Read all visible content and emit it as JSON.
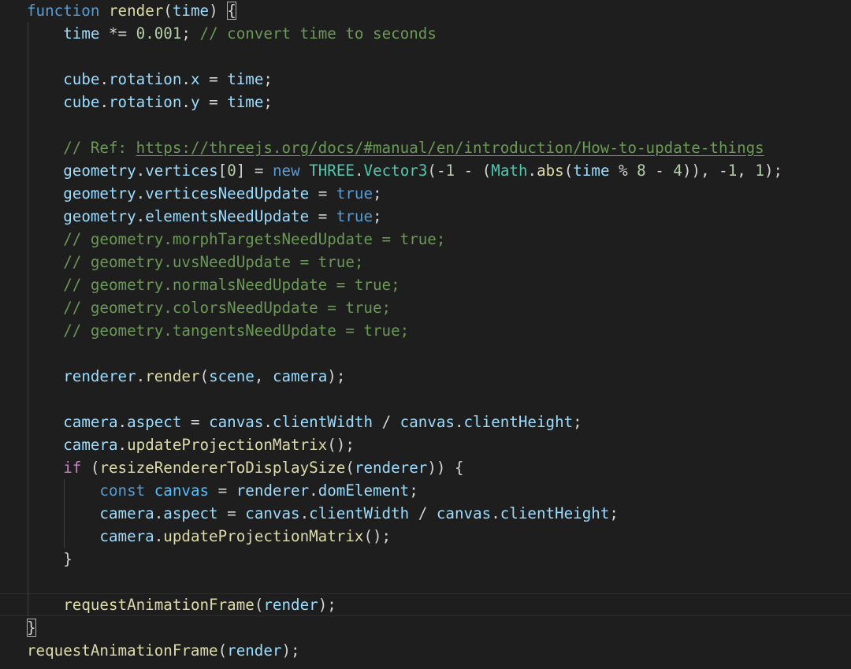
{
  "editor": {
    "theme": {
      "background": "#1e1e1e",
      "keyword": "#569cd6",
      "control": "#c586c0",
      "function": "#dcdcaa",
      "variable": "#9cdcfe",
      "constant": "#4fc1ff",
      "class": "#4ec9b0",
      "number": "#b5cea8",
      "comment": "#6a9955",
      "text": "#d4d4d4"
    },
    "lines": [
      {
        "indent": 0,
        "tokens": [
          [
            "kw",
            "function"
          ],
          [
            "pun",
            " "
          ],
          [
            "fn",
            "render"
          ],
          [
            "pun",
            "("
          ],
          [
            "var",
            "time"
          ],
          [
            "pun",
            ") "
          ],
          [
            "brm",
            "{"
          ]
        ]
      },
      {
        "indent": 1,
        "tokens": [
          [
            "pun",
            "    "
          ],
          [
            "var",
            "time"
          ],
          [
            "op",
            " *= "
          ],
          [
            "num",
            "0.001"
          ],
          [
            "pun",
            "; "
          ],
          [
            "com",
            "// convert time to seconds"
          ]
        ]
      },
      {
        "indent": 1,
        "tokens": []
      },
      {
        "indent": 1,
        "tokens": [
          [
            "pun",
            "    "
          ],
          [
            "var",
            "cube"
          ],
          [
            "pun",
            "."
          ],
          [
            "prop",
            "rotation"
          ],
          [
            "pun",
            "."
          ],
          [
            "prop",
            "x"
          ],
          [
            "op",
            " = "
          ],
          [
            "var",
            "time"
          ],
          [
            "pun",
            ";"
          ]
        ]
      },
      {
        "indent": 1,
        "tokens": [
          [
            "pun",
            "    "
          ],
          [
            "var",
            "cube"
          ],
          [
            "pun",
            "."
          ],
          [
            "prop",
            "rotation"
          ],
          [
            "pun",
            "."
          ],
          [
            "prop",
            "y"
          ],
          [
            "op",
            " = "
          ],
          [
            "var",
            "time"
          ],
          [
            "pun",
            ";"
          ]
        ]
      },
      {
        "indent": 1,
        "tokens": []
      },
      {
        "indent": 1,
        "tokens": [
          [
            "pun",
            "    "
          ],
          [
            "com",
            "// Ref: "
          ],
          [
            "lnk",
            "https://threejs.org/docs/#manual/en/introduction/How-to-update-things"
          ]
        ]
      },
      {
        "indent": 1,
        "tokens": [
          [
            "pun",
            "    "
          ],
          [
            "var",
            "geometry"
          ],
          [
            "pun",
            "."
          ],
          [
            "prop",
            "vertices"
          ],
          [
            "pun",
            "["
          ],
          [
            "num",
            "0"
          ],
          [
            "pun",
            "]"
          ],
          [
            "op",
            " = "
          ],
          [
            "kw",
            "new"
          ],
          [
            "pun",
            " "
          ],
          [
            "cls",
            "THREE"
          ],
          [
            "pun",
            "."
          ],
          [
            "cls",
            "Vector3"
          ],
          [
            "pun",
            "("
          ],
          [
            "op",
            "-"
          ],
          [
            "num",
            "1"
          ],
          [
            "op",
            " - "
          ],
          [
            "pun",
            "("
          ],
          [
            "cls",
            "Math"
          ],
          [
            "pun",
            "."
          ],
          [
            "fn",
            "abs"
          ],
          [
            "pun",
            "("
          ],
          [
            "var",
            "time"
          ],
          [
            "op",
            " % "
          ],
          [
            "num",
            "8"
          ],
          [
            "op",
            " - "
          ],
          [
            "num",
            "4"
          ],
          [
            "pun",
            "))"
          ],
          [
            "pun",
            ", "
          ],
          [
            "op",
            "-"
          ],
          [
            "num",
            "1"
          ],
          [
            "pun",
            ", "
          ],
          [
            "num",
            "1"
          ],
          [
            "pun",
            ");"
          ]
        ]
      },
      {
        "indent": 1,
        "tokens": [
          [
            "pun",
            "    "
          ],
          [
            "var",
            "geometry"
          ],
          [
            "pun",
            "."
          ],
          [
            "prop",
            "verticesNeedUpdate"
          ],
          [
            "op",
            " = "
          ],
          [
            "kw",
            "true"
          ],
          [
            "pun",
            ";"
          ]
        ]
      },
      {
        "indent": 1,
        "tokens": [
          [
            "pun",
            "    "
          ],
          [
            "var",
            "geometry"
          ],
          [
            "pun",
            "."
          ],
          [
            "prop",
            "elementsNeedUpdate"
          ],
          [
            "op",
            " = "
          ],
          [
            "kw",
            "true"
          ],
          [
            "pun",
            ";"
          ]
        ]
      },
      {
        "indent": 1,
        "tokens": [
          [
            "pun",
            "    "
          ],
          [
            "com",
            "// geometry.morphTargetsNeedUpdate = true;"
          ]
        ]
      },
      {
        "indent": 1,
        "tokens": [
          [
            "pun",
            "    "
          ],
          [
            "com",
            "// geometry.uvsNeedUpdate = true;"
          ]
        ]
      },
      {
        "indent": 1,
        "tokens": [
          [
            "pun",
            "    "
          ],
          [
            "com",
            "// geometry.normalsNeedUpdate = true;"
          ]
        ]
      },
      {
        "indent": 1,
        "tokens": [
          [
            "pun",
            "    "
          ],
          [
            "com",
            "// geometry.colorsNeedUpdate = true;"
          ]
        ]
      },
      {
        "indent": 1,
        "tokens": [
          [
            "pun",
            "    "
          ],
          [
            "com",
            "// geometry.tangentsNeedUpdate = true;"
          ]
        ]
      },
      {
        "indent": 1,
        "tokens": []
      },
      {
        "indent": 1,
        "tokens": [
          [
            "pun",
            "    "
          ],
          [
            "var",
            "renderer"
          ],
          [
            "pun",
            "."
          ],
          [
            "fn",
            "render"
          ],
          [
            "pun",
            "("
          ],
          [
            "var",
            "scene"
          ],
          [
            "pun",
            ", "
          ],
          [
            "var",
            "camera"
          ],
          [
            "pun",
            ");"
          ]
        ]
      },
      {
        "indent": 1,
        "tokens": []
      },
      {
        "indent": 1,
        "tokens": [
          [
            "pun",
            "    "
          ],
          [
            "var",
            "camera"
          ],
          [
            "pun",
            "."
          ],
          [
            "prop",
            "aspect"
          ],
          [
            "op",
            " = "
          ],
          [
            "var",
            "canvas"
          ],
          [
            "pun",
            "."
          ],
          [
            "prop",
            "clientWidth"
          ],
          [
            "op",
            " / "
          ],
          [
            "var",
            "canvas"
          ],
          [
            "pun",
            "."
          ],
          [
            "prop",
            "clientHeight"
          ],
          [
            "pun",
            ";"
          ]
        ]
      },
      {
        "indent": 1,
        "tokens": [
          [
            "pun",
            "    "
          ],
          [
            "var",
            "camera"
          ],
          [
            "pun",
            "."
          ],
          [
            "fn",
            "updateProjectionMatrix"
          ],
          [
            "pun",
            "();"
          ]
        ]
      },
      {
        "indent": 1,
        "tokens": [
          [
            "pun",
            "    "
          ],
          [
            "ctl",
            "if"
          ],
          [
            "pun",
            " ("
          ],
          [
            "fn",
            "resizeRendererToDisplaySize"
          ],
          [
            "pun",
            "("
          ],
          [
            "var",
            "renderer"
          ],
          [
            "pun",
            ")) {"
          ]
        ]
      },
      {
        "indent": 2,
        "tokens": [
          [
            "pun",
            "        "
          ],
          [
            "kw",
            "const"
          ],
          [
            "pun",
            " "
          ],
          [
            "cons",
            "canvas"
          ],
          [
            "op",
            " = "
          ],
          [
            "var",
            "renderer"
          ],
          [
            "pun",
            "."
          ],
          [
            "prop",
            "domElement"
          ],
          [
            "pun",
            ";"
          ]
        ]
      },
      {
        "indent": 2,
        "tokens": [
          [
            "pun",
            "        "
          ],
          [
            "var",
            "camera"
          ],
          [
            "pun",
            "."
          ],
          [
            "prop",
            "aspect"
          ],
          [
            "op",
            " = "
          ],
          [
            "var",
            "canvas"
          ],
          [
            "pun",
            "."
          ],
          [
            "prop",
            "clientWidth"
          ],
          [
            "op",
            " / "
          ],
          [
            "var",
            "canvas"
          ],
          [
            "pun",
            "."
          ],
          [
            "prop",
            "clientHeight"
          ],
          [
            "pun",
            ";"
          ]
        ]
      },
      {
        "indent": 2,
        "tokens": [
          [
            "pun",
            "        "
          ],
          [
            "var",
            "camera"
          ],
          [
            "pun",
            "."
          ],
          [
            "fn",
            "updateProjectionMatrix"
          ],
          [
            "pun",
            "();"
          ]
        ]
      },
      {
        "indent": 1,
        "tokens": [
          [
            "pun",
            "    }"
          ]
        ]
      },
      {
        "indent": 1,
        "tokens": []
      },
      {
        "indent": 1,
        "current": true,
        "tokens": [
          [
            "pun",
            "    "
          ],
          [
            "fn",
            "requestAnimationFrame"
          ],
          [
            "pun",
            "("
          ],
          [
            "var",
            "render"
          ],
          [
            "pun",
            ");"
          ]
        ]
      },
      {
        "indent": 0,
        "tokens": [
          [
            "brm",
            "}"
          ]
        ]
      },
      {
        "indent": 0,
        "tokens": [
          [
            "fn",
            "requestAnimationFrame"
          ],
          [
            "pun",
            "("
          ],
          [
            "var",
            "render"
          ],
          [
            "pun",
            ");"
          ]
        ]
      }
    ]
  }
}
